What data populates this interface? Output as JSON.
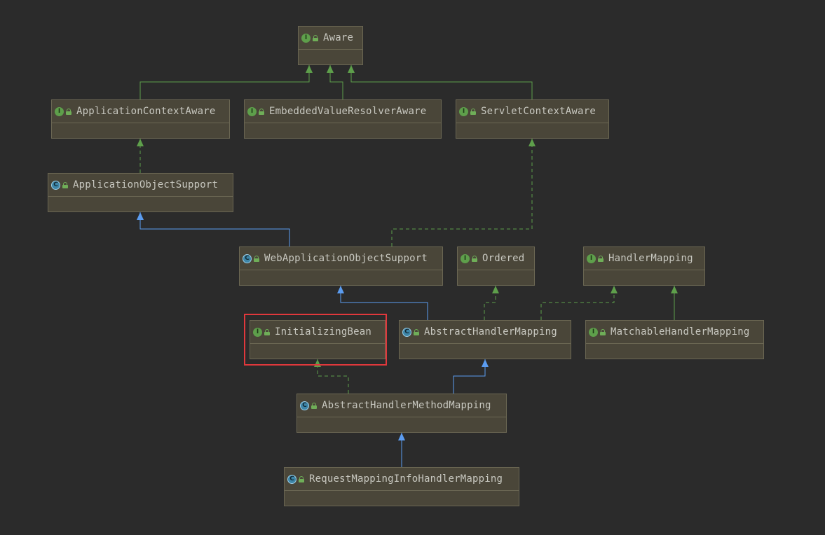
{
  "colors": {
    "background": "#2b2b2b",
    "node_fill": "#4a4639",
    "interface_edge": "#5e9f4b",
    "class_edge": "#5b9cf0",
    "highlight": "#e0383c"
  },
  "nodes": [
    {
      "id": "aware",
      "label": "Aware",
      "kind": "interface"
    },
    {
      "id": "application-context-aware",
      "label": "ApplicationContextAware",
      "kind": "interface"
    },
    {
      "id": "embedded-value-resolver-aware",
      "label": "EmbeddedValueResolverAware",
      "kind": "interface"
    },
    {
      "id": "servlet-context-aware",
      "label": "ServletContextAware",
      "kind": "interface"
    },
    {
      "id": "application-object-support",
      "label": "ApplicationObjectSupport",
      "kind": "abstract-class"
    },
    {
      "id": "web-application-object-support",
      "label": "WebApplicationObjectSupport",
      "kind": "abstract-class"
    },
    {
      "id": "ordered",
      "label": "Ordered",
      "kind": "interface"
    },
    {
      "id": "handler-mapping",
      "label": "HandlerMapping",
      "kind": "interface"
    },
    {
      "id": "initializing-bean",
      "label": "InitializingBean",
      "kind": "interface",
      "highlighted": true
    },
    {
      "id": "abstract-handler-mapping",
      "label": "AbstractHandlerMapping",
      "kind": "abstract-class"
    },
    {
      "id": "matchable-handler-mapping",
      "label": "MatchableHandlerMapping",
      "kind": "interface"
    },
    {
      "id": "abstract-handler-method-mapping",
      "label": "AbstractHandlerMethodMapping",
      "kind": "abstract-class"
    },
    {
      "id": "request-mapping-info-handler-mapping",
      "label": "RequestMappingInfoHandlerMapping",
      "kind": "class"
    }
  ],
  "edges": [
    {
      "from": "application-context-aware",
      "to": "aware",
      "type": "extends-interface"
    },
    {
      "from": "embedded-value-resolver-aware",
      "to": "aware",
      "type": "extends-interface"
    },
    {
      "from": "servlet-context-aware",
      "to": "aware",
      "type": "extends-interface"
    },
    {
      "from": "application-object-support",
      "to": "application-context-aware",
      "type": "implements"
    },
    {
      "from": "web-application-object-support",
      "to": "application-object-support",
      "type": "extends-class"
    },
    {
      "from": "web-application-object-support",
      "to": "servlet-context-aware",
      "type": "implements"
    },
    {
      "from": "abstract-handler-mapping",
      "to": "web-application-object-support",
      "type": "extends-class"
    },
    {
      "from": "abstract-handler-mapping",
      "to": "ordered",
      "type": "implements"
    },
    {
      "from": "abstract-handler-mapping",
      "to": "handler-mapping",
      "type": "implements"
    },
    {
      "from": "matchable-handler-mapping",
      "to": "handler-mapping",
      "type": "extends-interface"
    },
    {
      "from": "abstract-handler-method-mapping",
      "to": "abstract-handler-mapping",
      "type": "extends-class"
    },
    {
      "from": "abstract-handler-method-mapping",
      "to": "initializing-bean",
      "type": "implements"
    },
    {
      "from": "request-mapping-info-handler-mapping",
      "to": "abstract-handler-method-mapping",
      "type": "extends-class"
    }
  ]
}
